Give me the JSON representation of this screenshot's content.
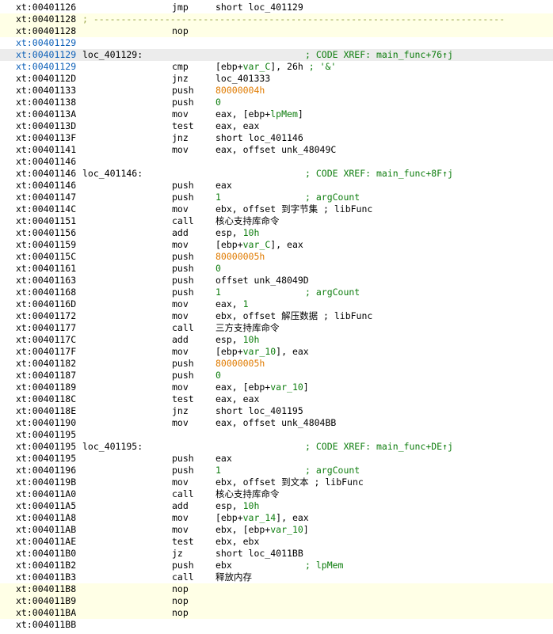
{
  "lines": [
    {
      "addr": "xt:00401126",
      "mn": "jmp",
      "ops": [
        {
          "t": "short loc_401129"
        }
      ]
    },
    {
      "addr": "xt:00401128",
      "sep": "; ---------------------------------------------------------------------------",
      "hl": true
    },
    {
      "addr": "xt:00401128",
      "mn": "nop",
      "hl": true
    },
    {
      "addr": "xt:00401129",
      "ac": "def"
    },
    {
      "addr": "xt:00401129",
      "ac": "def",
      "label": "loc_401129:",
      "comment": "; CODE XREF: main_func+76↑j",
      "cur": true
    },
    {
      "addr": "xt:00401129",
      "ac": "def",
      "mn": "cmp",
      "ops": [
        {
          "t": "[ebp+"
        },
        {
          "t": "var_C",
          "k": "var"
        },
        {
          "t": "], 26h"
        },
        {
          "t": " ; '&'",
          "k": "c"
        }
      ]
    },
    {
      "addr": "xt:0040112D",
      "mn": "jnz",
      "ops": [
        {
          "t": "loc_401333"
        }
      ]
    },
    {
      "addr": "xt:00401133",
      "mn": "push",
      "ops": [
        {
          "t": "80000004h",
          "k": "num"
        }
      ]
    },
    {
      "addr": "xt:00401138",
      "mn": "push",
      "ops": [
        {
          "t": "0",
          "k": "var"
        }
      ]
    },
    {
      "addr": "xt:0040113A",
      "mn": "mov",
      "ops": [
        {
          "t": "eax, [ebp+"
        },
        {
          "t": "lpMem",
          "k": "var"
        },
        {
          "t": "]"
        }
      ]
    },
    {
      "addr": "xt:0040113D",
      "mn": "test",
      "ops": [
        {
          "t": "eax, eax"
        }
      ]
    },
    {
      "addr": "xt:0040113F",
      "mn": "jnz",
      "ops": [
        {
          "t": "short loc_401146"
        }
      ]
    },
    {
      "addr": "xt:00401141",
      "mn": "mov",
      "ops": [
        {
          "t": "eax, offset unk_48049C"
        }
      ]
    },
    {
      "addr": "xt:00401146"
    },
    {
      "addr": "xt:00401146",
      "label": "loc_401146:",
      "comment": "; CODE XREF: main_func+8F↑j"
    },
    {
      "addr": "xt:00401146",
      "mn": "push",
      "ops": [
        {
          "t": "eax"
        }
      ]
    },
    {
      "addr": "xt:00401147",
      "mn": "push",
      "ops": [
        {
          "t": "1",
          "k": "var"
        }
      ],
      "comment": "; argCount"
    },
    {
      "addr": "xt:0040114C",
      "mn": "mov",
      "ops": [
        {
          "t": "ebx, offset 到字节集 ; libFunc"
        }
      ]
    },
    {
      "addr": "xt:00401151",
      "mn": "call",
      "ops": [
        {
          "t": "核心支持库命令"
        }
      ]
    },
    {
      "addr": "xt:00401156",
      "mn": "add",
      "ops": [
        {
          "t": "esp, "
        },
        {
          "t": "10h",
          "k": "var"
        }
      ]
    },
    {
      "addr": "xt:00401159",
      "mn": "mov",
      "ops": [
        {
          "t": "[ebp+"
        },
        {
          "t": "var_C",
          "k": "var"
        },
        {
          "t": "], eax"
        }
      ]
    },
    {
      "addr": "xt:0040115C",
      "mn": "push",
      "ops": [
        {
          "t": "80000005h",
          "k": "num"
        }
      ]
    },
    {
      "addr": "xt:00401161",
      "mn": "push",
      "ops": [
        {
          "t": "0",
          "k": "var"
        }
      ]
    },
    {
      "addr": "xt:00401163",
      "mn": "push",
      "ops": [
        {
          "t": "offset unk_48049D"
        }
      ]
    },
    {
      "addr": "xt:00401168",
      "mn": "push",
      "ops": [
        {
          "t": "1",
          "k": "var"
        }
      ],
      "comment": "; argCount"
    },
    {
      "addr": "xt:0040116D",
      "mn": "mov",
      "ops": [
        {
          "t": "eax, "
        },
        {
          "t": "1",
          "k": "var"
        }
      ]
    },
    {
      "addr": "xt:00401172",
      "mn": "mov",
      "ops": [
        {
          "t": "ebx, offset 解压数据 ; libFunc"
        }
      ]
    },
    {
      "addr": "xt:00401177",
      "mn": "call",
      "ops": [
        {
          "t": "三方支持库命令"
        }
      ]
    },
    {
      "addr": "xt:0040117C",
      "mn": "add",
      "ops": [
        {
          "t": "esp, "
        },
        {
          "t": "10h",
          "k": "var"
        }
      ]
    },
    {
      "addr": "xt:0040117F",
      "mn": "mov",
      "ops": [
        {
          "t": "[ebp+"
        },
        {
          "t": "var_10",
          "k": "var"
        },
        {
          "t": "], eax"
        }
      ]
    },
    {
      "addr": "xt:00401182",
      "mn": "push",
      "ops": [
        {
          "t": "80000005h",
          "k": "num"
        }
      ]
    },
    {
      "addr": "xt:00401187",
      "mn": "push",
      "ops": [
        {
          "t": "0",
          "k": "var"
        }
      ]
    },
    {
      "addr": "xt:00401189",
      "mn": "mov",
      "ops": [
        {
          "t": "eax, [ebp+"
        },
        {
          "t": "var_10",
          "k": "var"
        },
        {
          "t": "]"
        }
      ]
    },
    {
      "addr": "xt:0040118C",
      "mn": "test",
      "ops": [
        {
          "t": "eax, eax"
        }
      ]
    },
    {
      "addr": "xt:0040118E",
      "mn": "jnz",
      "ops": [
        {
          "t": "short loc_401195"
        }
      ]
    },
    {
      "addr": "xt:00401190",
      "mn": "mov",
      "ops": [
        {
          "t": "eax, offset unk_4804BB"
        }
      ]
    },
    {
      "addr": "xt:00401195"
    },
    {
      "addr": "xt:00401195",
      "label": "loc_401195:",
      "comment": "; CODE XREF: main_func+DE↑j"
    },
    {
      "addr": "xt:00401195",
      "mn": "push",
      "ops": [
        {
          "t": "eax"
        }
      ]
    },
    {
      "addr": "xt:00401196",
      "mn": "push",
      "ops": [
        {
          "t": "1",
          "k": "var"
        }
      ],
      "comment": "; argCount"
    },
    {
      "addr": "xt:0040119B",
      "mn": "mov",
      "ops": [
        {
          "t": "ebx, offset 到文本 ; libFunc"
        }
      ]
    },
    {
      "addr": "xt:004011A0",
      "mn": "call",
      "ops": [
        {
          "t": "核心支持库命令"
        }
      ]
    },
    {
      "addr": "xt:004011A5",
      "mn": "add",
      "ops": [
        {
          "t": "esp, "
        },
        {
          "t": "10h",
          "k": "var"
        }
      ]
    },
    {
      "addr": "xt:004011A8",
      "mn": "mov",
      "ops": [
        {
          "t": "[ebp+"
        },
        {
          "t": "var_14",
          "k": "var"
        },
        {
          "t": "], eax"
        }
      ]
    },
    {
      "addr": "xt:004011AB",
      "mn": "mov",
      "ops": [
        {
          "t": "ebx, [ebp+"
        },
        {
          "t": "var_10",
          "k": "var"
        },
        {
          "t": "]"
        }
      ]
    },
    {
      "addr": "xt:004011AE",
      "mn": "test",
      "ops": [
        {
          "t": "ebx, ebx"
        }
      ]
    },
    {
      "addr": "xt:004011B0",
      "mn": "jz",
      "ops": [
        {
          "t": "short loc_4011BB"
        }
      ]
    },
    {
      "addr": "xt:004011B2",
      "mn": "push",
      "ops": [
        {
          "t": "ebx"
        }
      ],
      "comment": "; lpMem"
    },
    {
      "addr": "xt:004011B3",
      "mn": "call",
      "ops": [
        {
          "t": "释放内存"
        }
      ]
    },
    {
      "addr": "xt:004011B8",
      "mn": "nop",
      "hl": true
    },
    {
      "addr": "xt:004011B9",
      "mn": "nop",
      "hl": true
    },
    {
      "addr": "xt:004011BA",
      "mn": "nop",
      "hl": true
    },
    {
      "addr": "xt:004011BB"
    }
  ]
}
